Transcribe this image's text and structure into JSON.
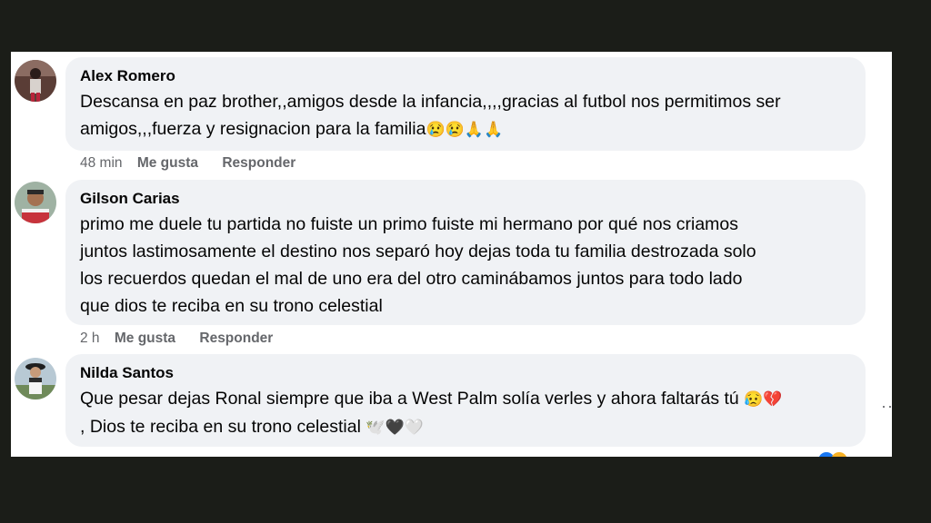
{
  "comments": [
    {
      "author": "Alex Romero",
      "lines": [
        "Descansa en paz brother,,amigos desde la infancia,,,,gracias al futbol nos permitimos ser",
        "amigos,,,fuerza y resignacion para la familia"
      ],
      "emojis": "😢😢🙏🙏",
      "time": "48 min",
      "like": "Me gusta",
      "reply": "Responder"
    },
    {
      "author": "Gilson Carias",
      "lines": [
        "primo me duele tu partida no fuiste un primo fuiste mi hermano por qué nos criamos",
        "juntos lastimosamente el destino nos separó hoy dejas toda tu familia destrozada solo",
        "los recuerdos quedan el mal de uno era del otro caminábamos juntos para todo lado",
        "que dios te reciba en su trono celestial"
      ],
      "time": "2 h",
      "like": "Me gusta",
      "reply": "Responder"
    },
    {
      "author": "Nilda Santos",
      "lines": [
        "Que pesar dejas Ronal siempre que iba a West Palm solía verles y ahora faltarás tú",
        ", Dios te reciba en su trono celestial"
      ],
      "emojis_line1": "😥💔",
      "emojis_line2": "🕊️🖤🤍"
    }
  ],
  "more_label": "··"
}
